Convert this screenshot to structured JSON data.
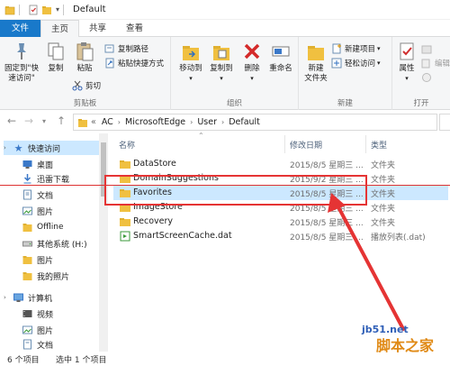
{
  "window": {
    "title": "Default"
  },
  "tabs": [
    "文件",
    "主页",
    "共享",
    "查看"
  ],
  "ribbon": {
    "clipboard": {
      "label": "剪贴板",
      "pin_label_1": "固定到\"快",
      "pin_label_2": "速访问\"",
      "copy": "复制",
      "paste": "粘贴",
      "copy_path": "复制路径",
      "paste_shortcut": "粘贴快捷方式",
      "cut": "剪切"
    },
    "organize": {
      "label": "组织",
      "move_to": "移动到",
      "copy_to": "复制到",
      "delete": "删除",
      "rename": "重命名"
    },
    "new": {
      "label": "新建",
      "new_folder_1": "新建",
      "new_folder_2": "文件夹",
      "new_item": "新建项目",
      "easy_access": "轻松访问"
    },
    "open": {
      "label": "打开",
      "properties": "属性",
      "edit": "编辑"
    }
  },
  "address": {
    "prefix": "«",
    "crumbs": [
      "AC",
      "MicrosoftEdge",
      "User",
      "Default"
    ]
  },
  "nav": {
    "items": [
      {
        "label": "快速访问",
        "icon": "star-icon",
        "pinned": false
      },
      {
        "label": "桌面",
        "icon": "desktop-icon",
        "pinned": true
      },
      {
        "label": "迅雷下载",
        "icon": "download-icon",
        "pinned": true
      },
      {
        "label": "文档",
        "icon": "document-icon",
        "pinned": true
      },
      {
        "label": "图片",
        "icon": "pictures-icon",
        "pinned": true
      },
      {
        "label": "Offline",
        "icon": "folder-icon",
        "pinned": false
      },
      {
        "label": "其他系统 (H:)",
        "icon": "drive-icon",
        "pinned": false
      },
      {
        "label": "图片",
        "icon": "folder-icon",
        "pinned": false
      },
      {
        "label": "我的照片",
        "icon": "folder-icon",
        "pinned": false
      },
      {
        "label": "计算机",
        "icon": "computer-icon",
        "pinned": false
      },
      {
        "label": "视频",
        "icon": "video-icon",
        "pinned": false
      },
      {
        "label": "图片",
        "icon": "pictures-icon",
        "pinned": false
      },
      {
        "label": "文档",
        "icon": "document-icon",
        "pinned": false
      }
    ]
  },
  "columns": {
    "name": "名称",
    "date": "修改日期",
    "type": "类型"
  },
  "files": [
    {
      "name": "DataStore",
      "date": "2015/8/5 星期三 ...",
      "type": "文件夹",
      "icon": "folder-icon"
    },
    {
      "name": "DomainSuggestions",
      "date": "2015/9/2 星期三 ...",
      "type": "文件夹",
      "icon": "folder-icon"
    },
    {
      "name": "Favorites",
      "date": "2015/8/5 星期三 ...",
      "type": "文件夹",
      "icon": "folder-icon",
      "selected": true
    },
    {
      "name": "ImageStore",
      "date": "2015/8/5 星期三 ...",
      "type": "文件夹",
      "icon": "folder-icon"
    },
    {
      "name": "Recovery",
      "date": "2015/8/5 星期三 ...",
      "type": "文件夹",
      "icon": "folder-icon"
    },
    {
      "name": "SmartScreenCache.dat",
      "date": "2015/8/5 星期三 ...",
      "type": "播放列表(.dat)",
      "icon": "dat-file-icon"
    }
  ],
  "status": {
    "count": "6 个项目",
    "selected": "选中 1 个项目"
  },
  "watermark": {
    "site": "jb51.net",
    "name": "脚本之家"
  },
  "colors": {
    "accent": "#1979ca",
    "selection": "#cce8ff",
    "annotation": "#e53434",
    "folder": "#f0c040"
  }
}
